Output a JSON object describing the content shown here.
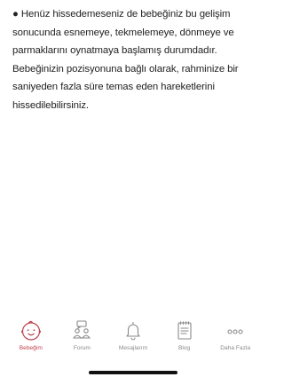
{
  "article": {
    "bullet": "●",
    "paragraph": "Henüz hissedemeseniz de bebeğiniz bu gelişim sonucunda esnemeye, tekmelemeye, dönmeye ve parmaklarını oynatmaya başlamış durumdadır. Bebeğinizin pozisyonuna bağlı olarak, rahminize bir saniyeden fazla süre temas eden hareketlerini hissedilebilirsiniz."
  },
  "tabbar": {
    "active_color": "#c0424e",
    "inactive_color": "#8a8a8a",
    "tabs": [
      {
        "label": "Bebeğim",
        "icon": "baby-face-icon",
        "active": true
      },
      {
        "label": "Forum",
        "icon": "forum-people-icon",
        "active": false
      },
      {
        "label": "Mesajlarım",
        "icon": "bell-icon",
        "active": false
      },
      {
        "label": "Blog",
        "icon": "blog-notebook-icon",
        "active": false
      },
      {
        "label": "Daha Fazla",
        "icon": "more-dots-icon",
        "active": false
      }
    ]
  }
}
